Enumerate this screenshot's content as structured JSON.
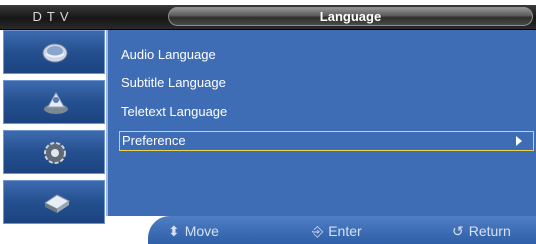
{
  "header": {
    "source_label": "DTV",
    "title": "Language"
  },
  "sidebar": {
    "icons": [
      {
        "name": "picture-icon"
      },
      {
        "name": "sound-icon"
      },
      {
        "name": "setup-icon"
      },
      {
        "name": "input-icon"
      }
    ]
  },
  "menu": {
    "items": [
      {
        "label": "Audio Language"
      },
      {
        "label": "Subtitle Language"
      },
      {
        "label": "Teletext Language"
      },
      {
        "label": "Preference",
        "selected": true
      }
    ]
  },
  "footer": {
    "move_label": "Move",
    "enter_label": "Enter",
    "return_label": "Return"
  },
  "colors": {
    "panel": "#3f6db5",
    "selection_border": "#e9d44b",
    "title_bar": "#151515"
  }
}
